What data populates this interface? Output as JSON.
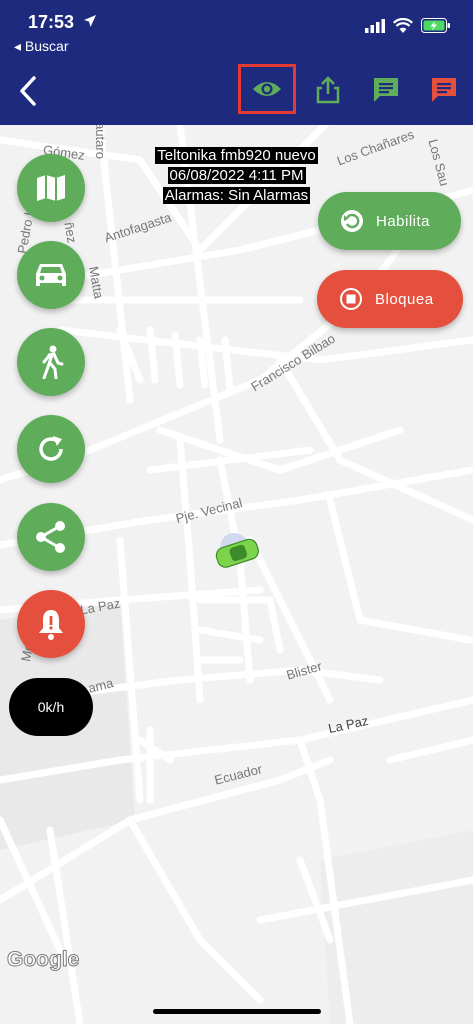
{
  "status_bar": {
    "time": "17:53",
    "back_app": "◂ Buscar"
  },
  "info": {
    "device": "Teltonika fmb920 nuevo",
    "datetime": "06/08/2022 4:11 PM",
    "alarms": "Alarmas: Sin Alarmas"
  },
  "actions": {
    "enable_label": "Habilita",
    "block_label": "Bloquea"
  },
  "speed": "0k/h",
  "streets": {
    "gomez": "Gómez",
    "antofagasta": "Antofagasta",
    "matta": "Matta",
    "los_chanares": "Los Chañares",
    "los_sau": "Los Sau",
    "francisco_bilbao": "Francisco Bilbao",
    "pje_vecinal": "Pje. Vecinal",
    "la_paz_left": "La Paz",
    "la_paz_right": "La Paz",
    "blister": "Blister",
    "ecuador": "Ecuador",
    "pedro_la": "Pedro La",
    "nez": "ñez",
    "autaro": "autaro",
    "ama": "ama",
    "me": "Me"
  },
  "brand": "Google",
  "colors": {
    "header": "#1e2a7e",
    "green": "#5fad5b",
    "red": "#e5503e",
    "highlight": "#e53935"
  },
  "icons": [
    "navigation-arrow-icon",
    "signal-icon",
    "wifi-icon",
    "battery-icon",
    "back-chevron-icon",
    "eye-icon",
    "share-icon",
    "message-icon",
    "map-icon",
    "car-icon",
    "walk-icon",
    "refresh-icon",
    "share-nodes-icon",
    "alarm-bell-icon",
    "restart-icon",
    "stop-icon",
    "vehicle-marker-icon"
  ]
}
